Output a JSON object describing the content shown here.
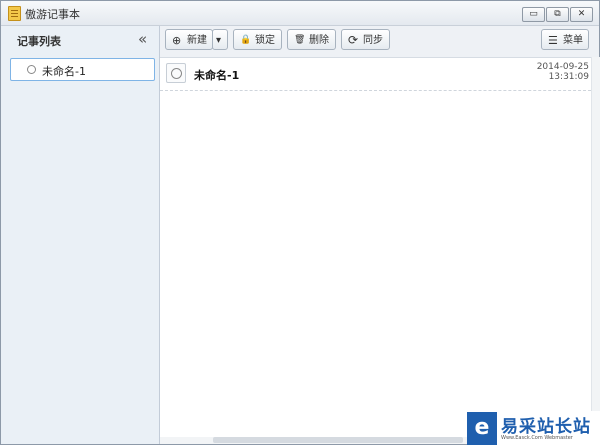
{
  "window": {
    "title": "傲游记事本",
    "icon": "notepad-icon",
    "controls": {
      "minimize": "▭",
      "restore": "⧉",
      "close": "✕"
    }
  },
  "sidebar": {
    "title": "记事列表",
    "collapse_icon": "«",
    "items": [
      {
        "label": "未命名-1",
        "selected": true
      }
    ]
  },
  "toolbar": {
    "new_label": "新建",
    "lock_label": "锁定",
    "delete_label": "删除",
    "sync_label": "同步",
    "menu_label": "菜单",
    "icons": {
      "new": "⊕",
      "dropdown": "▾",
      "lock": "🔒",
      "delete": "🗑",
      "sync": "⟳",
      "menu": "☰"
    }
  },
  "notes": [
    {
      "title": "未命名-1",
      "date": "2014-09-25",
      "time": "13:31:09"
    }
  ],
  "watermark": {
    "logo": "e",
    "text": "易采站长站",
    "subtext": "Www.Easck.Com Webmaster"
  },
  "colors": {
    "accent": "#1f5fae",
    "selection_border": "#7fb4e6",
    "sidebar_bg": "#eaf0f6"
  }
}
